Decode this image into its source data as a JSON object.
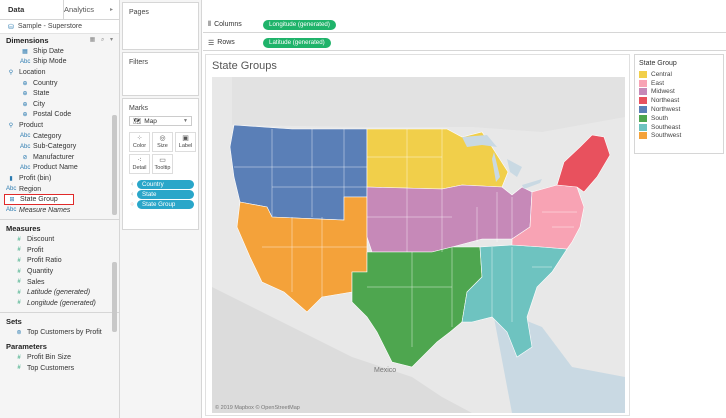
{
  "data_pane": {
    "tab_data": "Data",
    "tab_analytics": "Analytics",
    "data_source": "Sample - Superstore",
    "dimensions_header": "Dimensions",
    "dimensions": [
      {
        "label": "Ship Date",
        "icon": "calendar-icon",
        "italic": false
      },
      {
        "label": "Ship Mode",
        "icon": "abc-icon",
        "italic": false
      },
      {
        "label": "Location",
        "icon": "hierarchy-icon",
        "italic": false
      },
      {
        "label": "Country",
        "icon": "globe-icon",
        "italic": false
      },
      {
        "label": "State",
        "icon": "globe-icon",
        "italic": false
      },
      {
        "label": "City",
        "icon": "globe-icon",
        "italic": false
      },
      {
        "label": "Postal Code",
        "icon": "globe-icon",
        "italic": false
      },
      {
        "label": "Product",
        "icon": "hierarchy-icon",
        "italic": false
      },
      {
        "label": "Category",
        "icon": "abc-icon",
        "italic": false
      },
      {
        "label": "Sub-Category",
        "icon": "abc-icon",
        "italic": false
      },
      {
        "label": "Manufacturer",
        "icon": "paperclip-icon",
        "italic": false
      },
      {
        "label": "Product Name",
        "icon": "abc-icon",
        "italic": false
      },
      {
        "label": "Profit (bin)",
        "icon": "bar-icon",
        "italic": false
      },
      {
        "label": "Region",
        "icon": "abc-icon",
        "italic": false
      },
      {
        "label": "State Group",
        "icon": "group-icon",
        "italic": false
      },
      {
        "label": "Measure Names",
        "icon": "abc-icon",
        "italic": true
      }
    ],
    "measures_header": "Measures",
    "measures": [
      {
        "label": "Discount",
        "italic": false
      },
      {
        "label": "Profit",
        "italic": false
      },
      {
        "label": "Profit Ratio",
        "italic": false
      },
      {
        "label": "Quantity",
        "italic": false
      },
      {
        "label": "Sales",
        "italic": false
      },
      {
        "label": "Latitude (generated)",
        "italic": true
      },
      {
        "label": "Longitude (generated)",
        "italic": true
      }
    ],
    "sets_header": "Sets",
    "sets": [
      "Top Customers by Profit"
    ],
    "parameters_header": "Parameters",
    "parameters": [
      "Profit Bin Size",
      "Top Customers"
    ]
  },
  "cards": {
    "pages": "Pages",
    "filters": "Filters",
    "marks": "Marks",
    "mark_type": "Map",
    "mark_buttons": [
      "Color",
      "Size",
      "Label",
      "Detail",
      "Tooltip"
    ],
    "mark_pills": [
      {
        "label": "Country",
        "icon": "detail-icon"
      },
      {
        "label": "State",
        "icon": "detail-icon"
      },
      {
        "label": "State Group",
        "icon": "color-icon"
      }
    ]
  },
  "shelves": {
    "columns_label": "Columns",
    "columns_pill": "Longitude (generated)",
    "rows_label": "Rows",
    "rows_pill": "Latitude (generated)"
  },
  "viz": {
    "title": "State Groups",
    "credit": "© 2019 Mapbox © OpenStreetMap",
    "map_label": "Mexico"
  },
  "legend": {
    "title": "State Group",
    "items": [
      {
        "label": "Central",
        "color": "#f1cf4a"
      },
      {
        "label": "East",
        "color": "#f8a3b4"
      },
      {
        "label": "Midwest",
        "color": "#c689b8"
      },
      {
        "label": "Northeast",
        "color": "#e8515e"
      },
      {
        "label": "Northwest",
        "color": "#5a7fb7"
      },
      {
        "label": "South",
        "color": "#4ea64f"
      },
      {
        "label": "Southeast",
        "color": "#6ec3c0"
      },
      {
        "label": "Southwest",
        "color": "#f4a23a"
      }
    ]
  }
}
